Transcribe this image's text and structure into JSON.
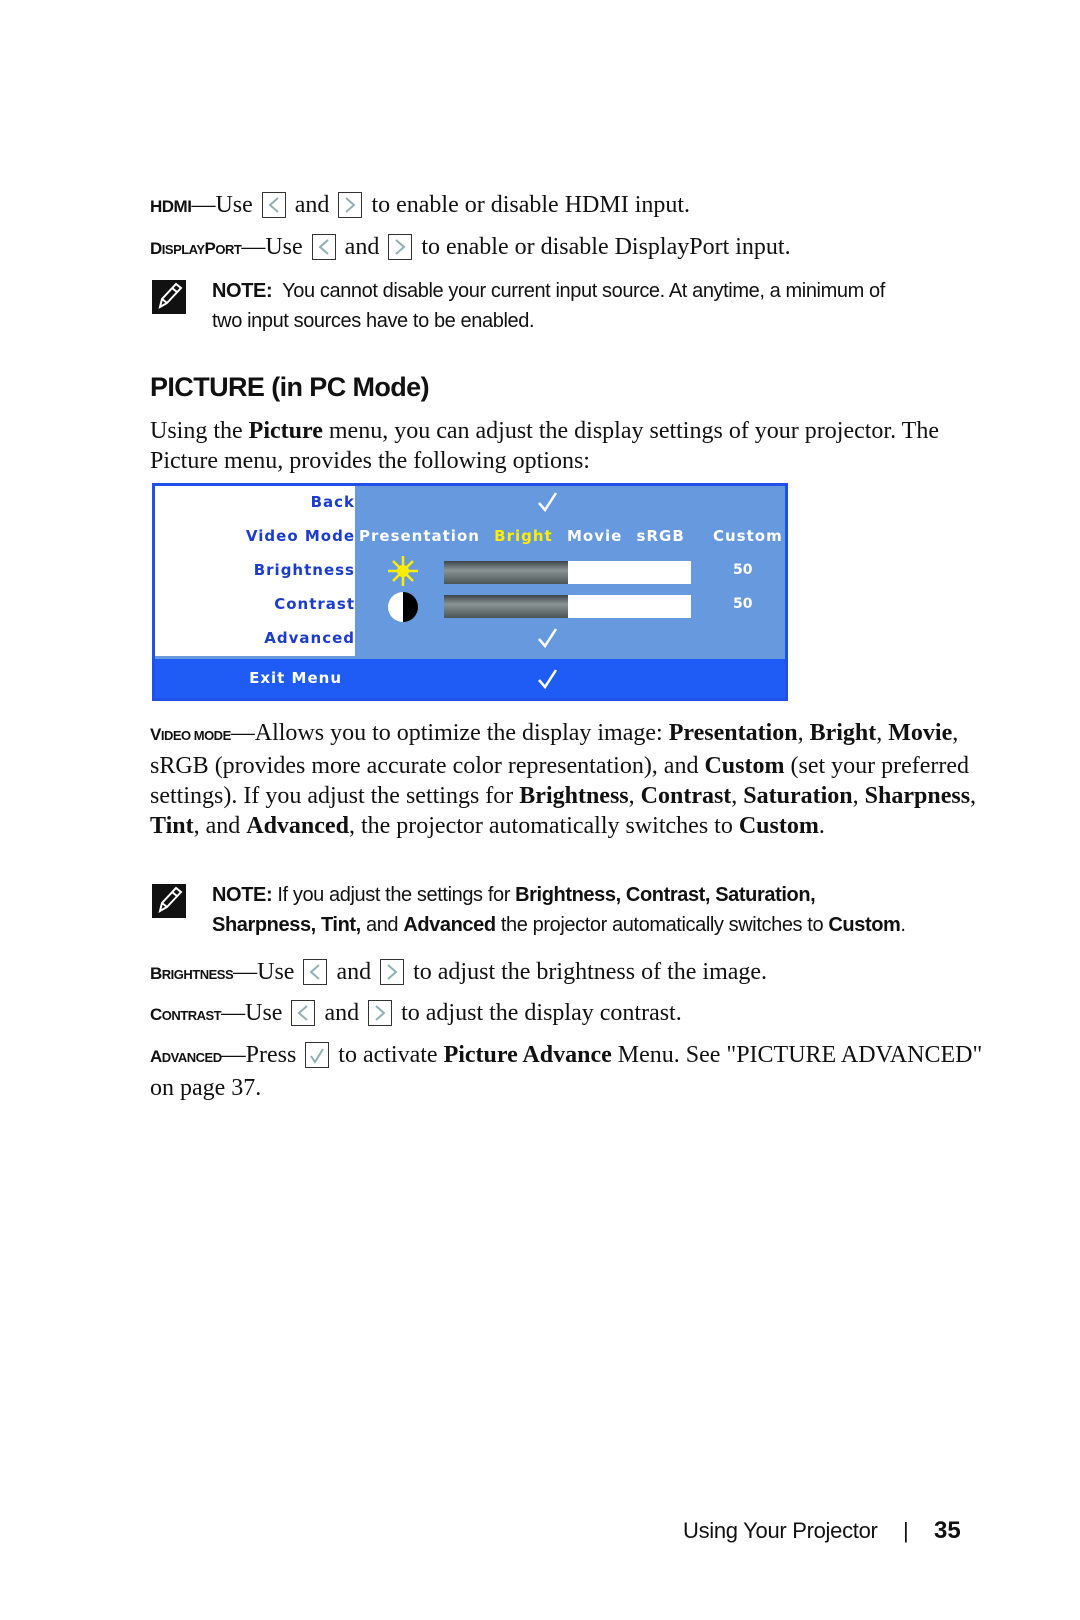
{
  "hdmi": {
    "lead": "HDMI",
    "use": "—Use",
    "and": "and",
    "rest": "to enable or disable HDMI input."
  },
  "displayport": {
    "lead_big1": "D",
    "lead_small1": "ISPLAY",
    "lead_big2": "P",
    "lead_small2": "ORT",
    "use": "—Use",
    "and": "and",
    "rest": "to enable or disable DisplayPort input."
  },
  "note1": {
    "label": "NOTE:",
    "line1": "You cannot disable your current input source. At anytime, a minimum of",
    "line2": "two input sources have to be enabled."
  },
  "section_title": "PICTURE (in PC Mode)",
  "intro": {
    "p1": "Using the ",
    "b1": "Picture",
    "p2": " menu, you can adjust the display settings of your projector. The Picture menu, provides the following options:"
  },
  "osd": {
    "colors": {
      "border": "#2050e8",
      "panel": "#6699dd",
      "label": "#1a3cd0",
      "exit_bg": "#1e5cf5",
      "selected": "#ffee00"
    },
    "rows": [
      {
        "label": "Back"
      },
      {
        "label": "Video Mode"
      },
      {
        "label": "Brightness"
      },
      {
        "label": "Contrast"
      },
      {
        "label": "Advanced"
      }
    ],
    "exit_label": "Exit Menu",
    "video_modes": [
      "Presentation",
      "Bright",
      "Movie",
      "sRGB",
      "Custom"
    ],
    "selected_mode": "Bright",
    "brightness": {
      "value": "50",
      "level_percent": 50
    },
    "contrast": {
      "value": "50",
      "level_percent": 50
    }
  },
  "video_mode": {
    "lead_big": "V",
    "lead_small": "IDEO MODE",
    "t1": "—Allows you to optimize the display image: ",
    "b1": "Presentation",
    "t2": ", ",
    "b2": "Bright",
    "t3": ", ",
    "b3": "Movie",
    "t4": ", sRGB (provides more accurate color representation), and ",
    "b4": "Custom",
    "t5": " (set your preferred settings). If you adjust the settings for ",
    "b5": "Brightness",
    "t6": ", ",
    "b6": "Contrast",
    "t7": ", ",
    "b7": "Saturation",
    "t8": ", ",
    "b8": "Sharpness",
    "t9": ", ",
    "b9": "Tint",
    "t10": ", and ",
    "b10": "Advanced",
    "t11": ", the projector automatically switches to ",
    "b11": "Custom",
    "t12": "."
  },
  "note2": {
    "label": "NOTE:",
    "t1": " If you adjust the settings for ",
    "b1": "Brightness, Contrast, Saturation,",
    "b2": "Sharpness, Tint,",
    "t2": " and ",
    "b3": "Advanced",
    "t3": " the projector automatically switches to ",
    "b4": "Custom",
    "t4": "."
  },
  "brightness": {
    "lead_big": "B",
    "lead_small": "RIGHTNESS",
    "use": "—Use",
    "and": "and",
    "rest": "to adjust the brightness of the image."
  },
  "contrast": {
    "lead_big": "C",
    "lead_small": "ONTRAST",
    "use": "—Use",
    "and": "and",
    "rest": "to adjust the display contrast."
  },
  "advanced": {
    "lead_big": "A",
    "lead_small": "DVANCED",
    "press": "—Press",
    "t1": " to activate ",
    "b1": "Picture Advance",
    "t2": " Menu. See \"PICTURE ADVANCED\" on page 37."
  },
  "footer": {
    "label": "Using Your Projector",
    "separator": "|",
    "page": "35"
  }
}
